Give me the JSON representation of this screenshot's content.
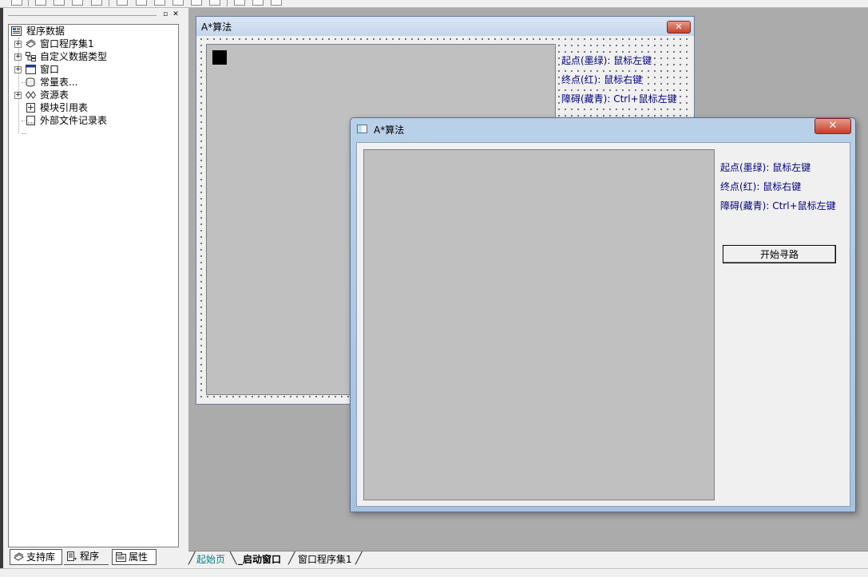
{
  "left_panel": {
    "tree": {
      "root_label": "程序数据",
      "items": [
        {
          "label": "窗口程序集1",
          "icon": "window-program-set-icon"
        },
        {
          "label": "自定义数据类型",
          "icon": "custom-type-icon"
        },
        {
          "label": "窗口",
          "icon": "window-icon"
        },
        {
          "label": "常量表...",
          "icon": "constant-table-icon"
        },
        {
          "label": "资源表",
          "icon": "resource-table-icon"
        },
        {
          "label": "模块引用表",
          "icon": "module-ref-icon"
        },
        {
          "label": "外部文件记录表",
          "icon": "external-file-icon"
        }
      ]
    },
    "tabs": [
      {
        "label": "支持库",
        "icon": "support-lib-icon"
      },
      {
        "label": "程序",
        "icon": "program-icon"
      },
      {
        "label": "属性",
        "icon": "property-icon"
      }
    ]
  },
  "design_form": {
    "title": "A*算法",
    "close_label": "✕",
    "labels": {
      "start": "起点(墨绿): 鼠标左键",
      "end": "终点(红): 鼠标右键",
      "obstacle": "障碍(藏青): Ctrl+鼠标左键"
    }
  },
  "run_window": {
    "title": "A*算法",
    "close_label": "✕",
    "labels": {
      "start": "起点(墨绿): 鼠标左键",
      "end": "终点(红): 鼠标右键",
      "obstacle": "障碍(藏青): Ctrl+鼠标左键"
    },
    "start_button": "开始寻路"
  },
  "doc_tabs": [
    {
      "label": "起始页",
      "active": false
    },
    {
      "label": "_启动窗口",
      "active": true
    },
    {
      "label": "窗口程序集1",
      "active": false
    }
  ],
  "colors": {
    "label_text": "#000080",
    "canvas_bg": "#c0c0c0",
    "designer_bg": "#ababab"
  }
}
